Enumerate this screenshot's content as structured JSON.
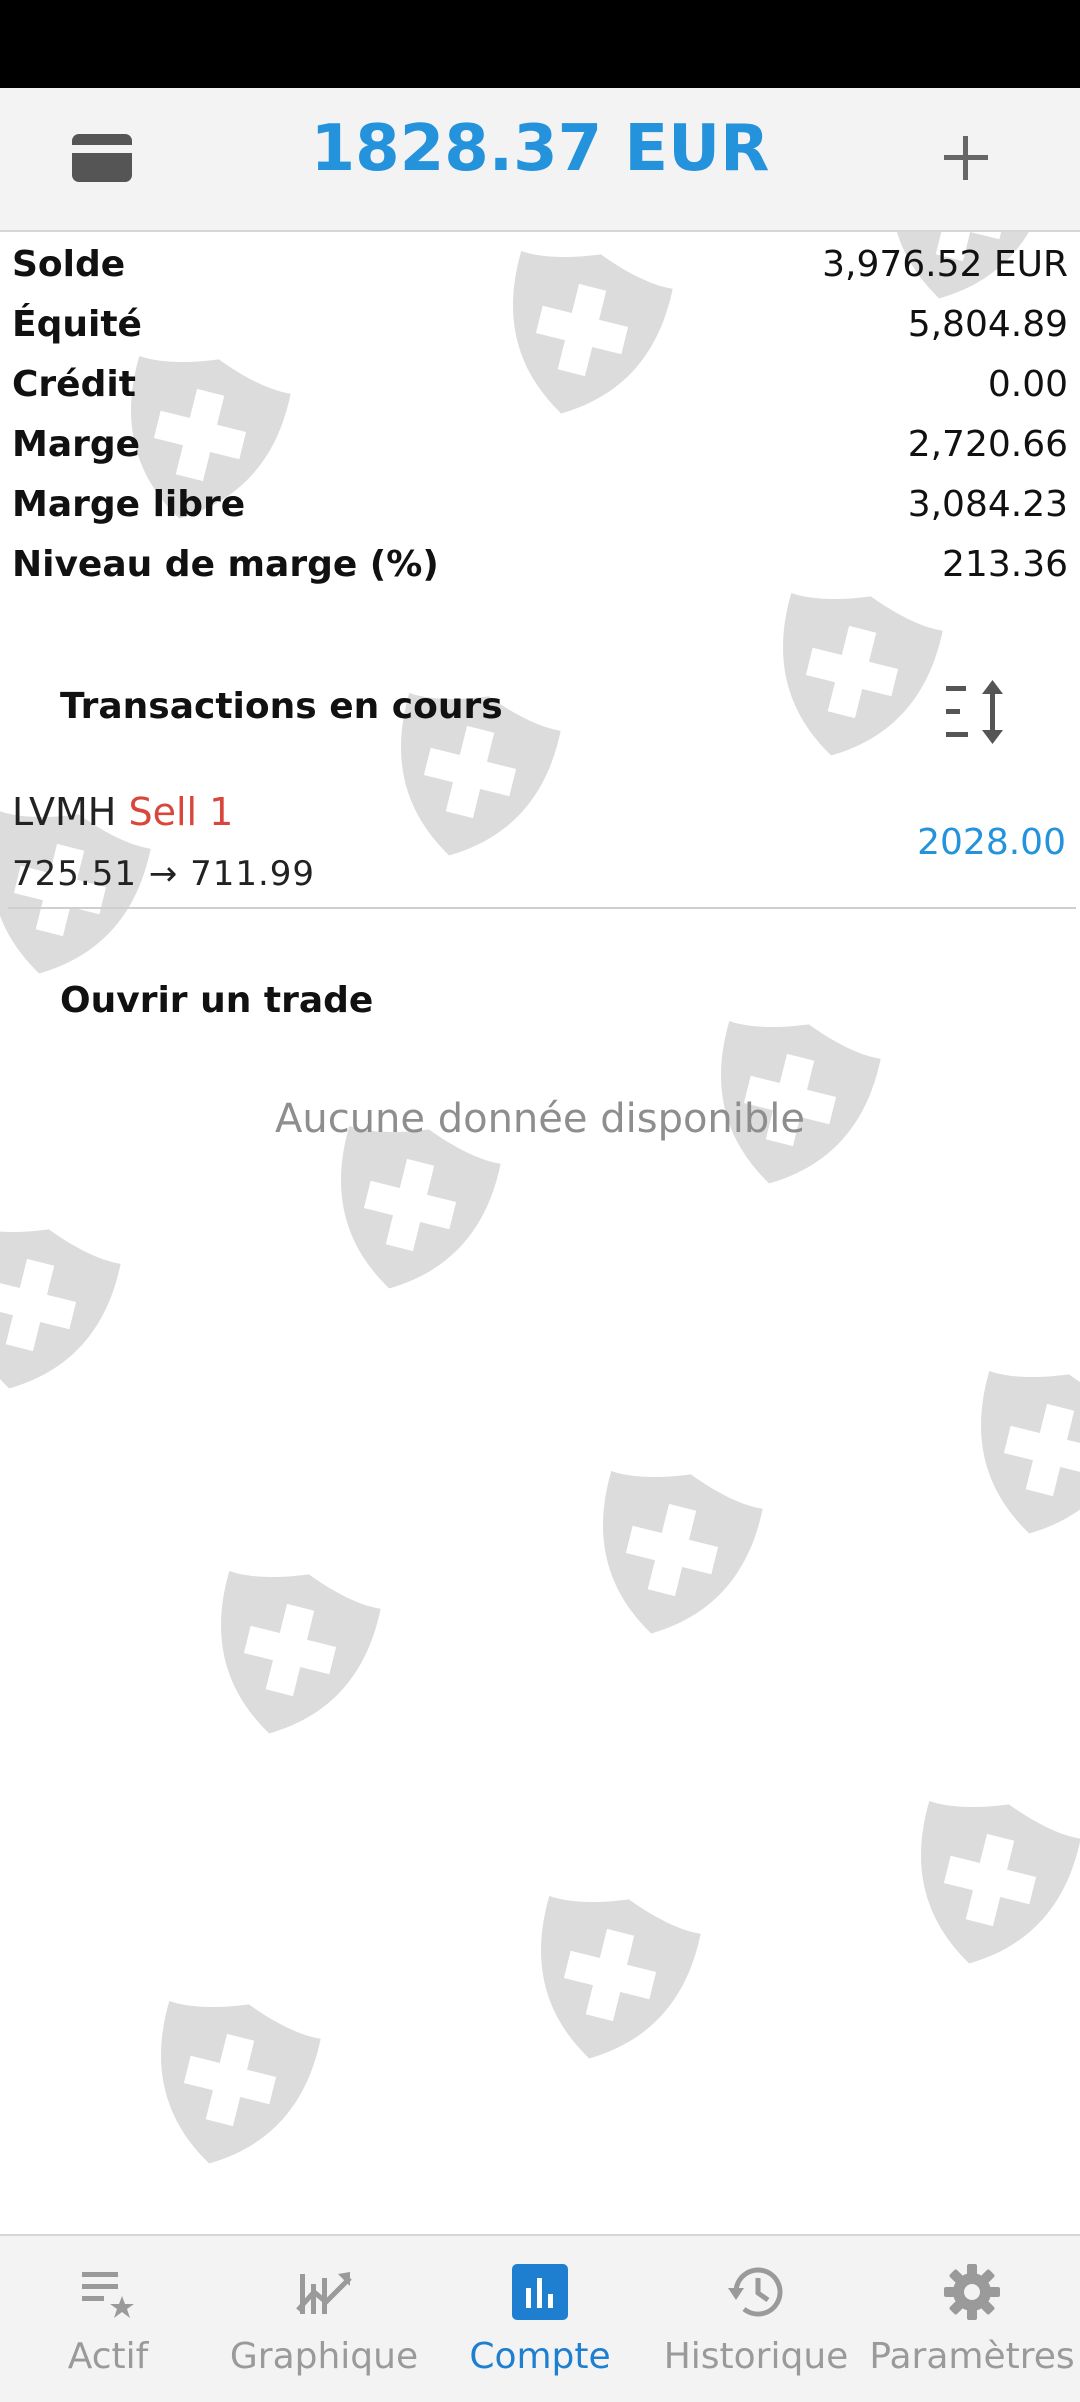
{
  "header": {
    "title": "1828.37 EUR",
    "card_icon": "credit-card-icon",
    "add_icon": "plus-icon"
  },
  "summary": [
    {
      "label": "Solde",
      "value": "3,976.52 EUR"
    },
    {
      "label": "Équité",
      "value": "5,804.89"
    },
    {
      "label": "Crédit",
      "value": "0.00"
    },
    {
      "label": "Marge",
      "value": "2,720.66"
    },
    {
      "label": "Marge libre",
      "value": "3,084.23"
    },
    {
      "label": "Niveau de marge (%)",
      "value": "213.36"
    }
  ],
  "open_trades": {
    "title": "Transactions en cours",
    "sort_icon": "sort-icon",
    "items": [
      {
        "symbol": "LVMH",
        "side": "Sell 1",
        "prices": "725.51 → 711.99",
        "profit": "2028.00"
      }
    ]
  },
  "open_trade": {
    "title": "Ouvrir un trade",
    "empty": "Aucune donnée disponible"
  },
  "bottom_nav": [
    {
      "label": "Actif",
      "icon": "star-list-icon",
      "active": false
    },
    {
      "label": "Graphique",
      "icon": "chart-icon",
      "active": false
    },
    {
      "label": "Compte",
      "icon": "bar-chart-icon",
      "active": true
    },
    {
      "label": "Historique",
      "icon": "history-icon",
      "active": false
    },
    {
      "label": "Paramètres",
      "icon": "gear-icon",
      "active": false
    }
  ],
  "colors": {
    "accent": "#2493dc",
    "sell": "#d9463b",
    "nav_active": "#1e7fd0",
    "nav_inactive": "#9a9a9a"
  }
}
